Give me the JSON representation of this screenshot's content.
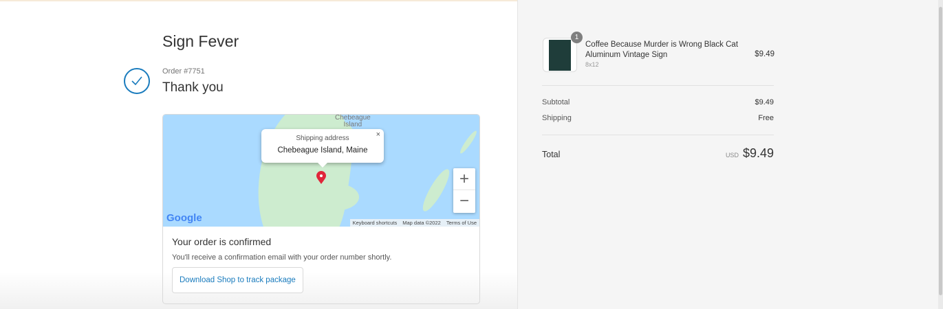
{
  "shop_name": "Sign Fever",
  "order_number": "Order #7751",
  "thank_you": "Thank you",
  "map": {
    "popup_title": "Shipping address",
    "popup_address": "Chebeague Island, Maine",
    "island_label_top": "Chebeague",
    "island_label": "Island",
    "logo": "Google",
    "zoom_in": "+",
    "zoom_out": "−",
    "close": "×",
    "attribution": [
      "Keyboard shortcuts",
      "Map data ©2022",
      "Terms of Use"
    ]
  },
  "confirmation": {
    "title": "Your order is confirmed",
    "message": "You'll receive a confirmation email with your order number shortly.",
    "button": "Download Shop to track package"
  },
  "summary": {
    "item": {
      "quantity": "1",
      "name": "Coffee Because Murder is Wrong Black Cat Aluminum Vintage Sign",
      "variant": "8x12",
      "price": "$9.49"
    },
    "subtotal_label": "Subtotal",
    "subtotal": "$9.49",
    "shipping_label": "Shipping",
    "shipping": "Free",
    "total_label": "Total",
    "currency": "USD",
    "total": "$9.49"
  },
  "colors": {
    "accent": "#197bbd",
    "pin": "#e0263a"
  }
}
